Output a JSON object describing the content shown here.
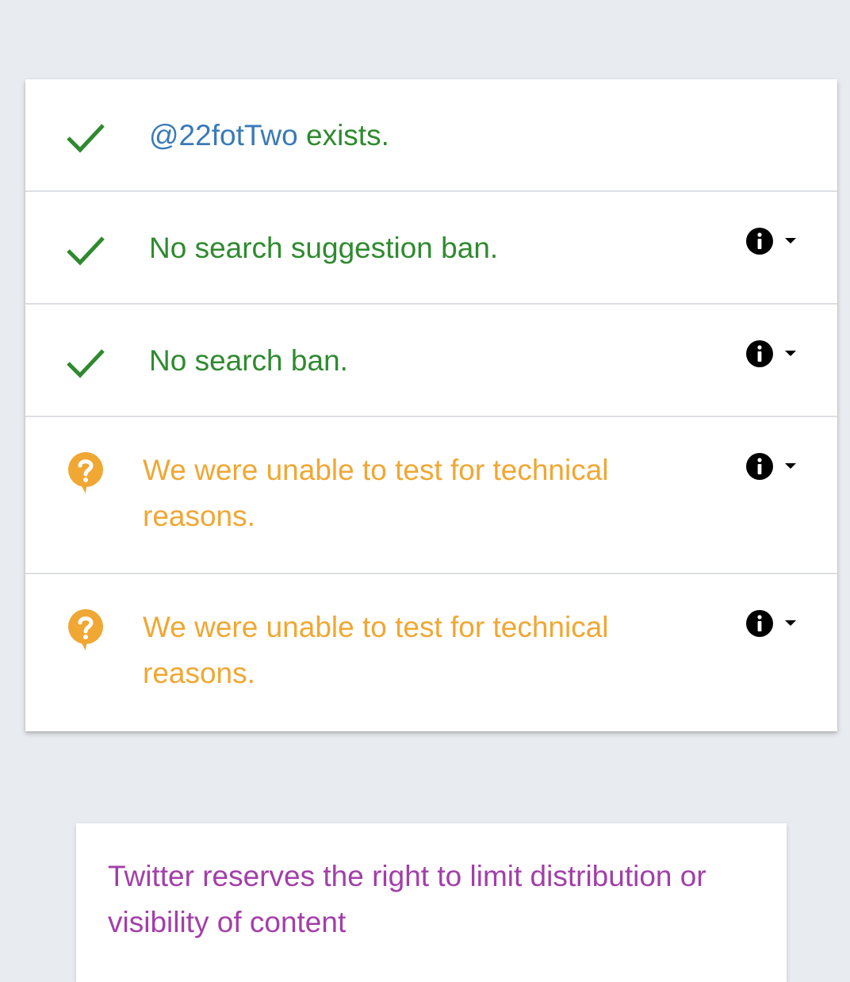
{
  "results": {
    "rows": [
      {
        "status": "check",
        "handle": "@22fotTwo",
        "text": " exists."
      },
      {
        "status": "check",
        "text": "No search suggestion ban."
      },
      {
        "status": "check",
        "text": "No search ban."
      },
      {
        "status": "unknown",
        "text": "We were unable to test for technical reasons."
      },
      {
        "status": "unknown",
        "text": "We were unable to test for technical reasons."
      }
    ]
  },
  "notice": {
    "text": "Twitter reserves the right to limit distribution or visibility of content"
  },
  "colors": {
    "success": "#2f8a2f",
    "handle": "#3a7ab8",
    "warning": "#f0a733",
    "notice": "#a23fa8",
    "background": "#e8ecf0"
  },
  "icons": {
    "check": "check-icon",
    "unknown": "question-bubble-icon",
    "info": "info-icon",
    "expand": "caret-down-icon"
  }
}
